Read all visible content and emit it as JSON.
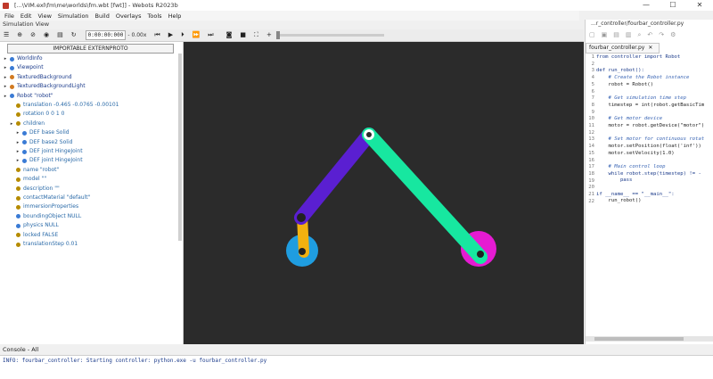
{
  "window": {
    "title": "[...\\VIM.exl\\fm\\me\\worlds\\fm.wbt [fwt]] - Webots R2023b",
    "minimize": "—",
    "maximize": "☐",
    "close": "✕"
  },
  "menu": [
    "File",
    "Edit",
    "View",
    "Simulation",
    "Build",
    "Overlays",
    "Tools",
    "Help"
  ],
  "simulation_view_label": "Simulation View",
  "toolbar": {
    "time": "0:00:00:000",
    "speed": "- 0.00x",
    "icons": [
      "menu-icon",
      "add-node-icon",
      "open-icon",
      "view-icon",
      "save-icon",
      "reload-icon",
      "step-back-icon",
      "play-icon",
      "step-icon",
      "run-fast-icon",
      "fast-forward-icon",
      "screenshot-icon",
      "record-icon",
      "fullscreen-icon",
      "plus-icon"
    ]
  },
  "scene_tree": {
    "extern_button": "IMPORTABLE EXTERNPROTO",
    "rows": [
      {
        "label": "WorldInfo",
        "color": "#3a7bd5",
        "indent": 0
      },
      {
        "label": "Viewpoint",
        "color": "#3a7bd5",
        "indent": 0
      },
      {
        "label": "TexturedBackground",
        "color": "#d17a22",
        "indent": 0
      },
      {
        "label": "TexturedBackgroundLight",
        "color": "#d17a22",
        "indent": 0
      },
      {
        "label": "Robot \"robot\"",
        "color": "#3a7bd5",
        "indent": 0
      },
      {
        "label": "translation -0.465 -0.0765 -0.00101",
        "color": "#b58b00",
        "indent": 1
      },
      {
        "label": "rotation 0 0 1 0",
        "color": "#b58b00",
        "indent": 1
      },
      {
        "label": "children",
        "color": "#b58b00",
        "indent": 1
      },
      {
        "label": "DEF base Solid",
        "color": "#3a7bd5",
        "indent": 2
      },
      {
        "label": "DEF base2 Solid",
        "color": "#3a7bd5",
        "indent": 2
      },
      {
        "label": "DEF joint HingeJoint",
        "color": "#3a7bd5",
        "indent": 2
      },
      {
        "label": "DEF joint HingeJoint",
        "color": "#3a7bd5",
        "indent": 2
      },
      {
        "label": "name \"robot\"",
        "color": "#b58b00",
        "indent": 1
      },
      {
        "label": "model \"\"",
        "color": "#b58b00",
        "indent": 1
      },
      {
        "label": "description \"\"",
        "color": "#b58b00",
        "indent": 1
      },
      {
        "label": "contactMaterial \"default\"",
        "color": "#b58b00",
        "indent": 1
      },
      {
        "label": "immersionProperties",
        "color": "#b58b00",
        "indent": 1
      },
      {
        "label": "boundingObject NULL",
        "color": "#3a7bd5",
        "indent": 1
      },
      {
        "label": "physics NULL",
        "color": "#3a7bd5",
        "indent": 1
      },
      {
        "label": "locked FALSE",
        "color": "#b58b00",
        "indent": 1
      },
      {
        "label": "translationStep 0.01",
        "color": "#b58b00",
        "indent": 1
      }
    ]
  },
  "editor": {
    "path": "...r_controller/fourbar_controller.py",
    "tab": "fourbar_controller.py",
    "tab_close": "✕",
    "line_numbers": [
      "1",
      "2",
      "3",
      "4",
      "5",
      "6",
      "7",
      "8",
      "9",
      "10",
      "11",
      "12",
      "13",
      "14",
      "15",
      "16",
      "17",
      "18",
      "19",
      "20",
      "21",
      "22"
    ],
    "lines": [
      "from controller import Robot",
      "",
      "def run_robot():",
      "    # Create the Robot instance",
      "    robot = Robot()",
      "",
      "    # Get simulation time step",
      "    timestep = int(robot.getBasicTim",
      "",
      "    # Get motor device",
      "    motor = robot.getDevice(\"motor\")",
      "",
      "    # Set motor for continuous rotat",
      "    motor.setPosition(float('inf'))",
      "    motor.setVelocity(1.0)",
      "",
      "    # Main control loop",
      "    while robot.step(timestep) != -",
      "        pass",
      "",
      "if __name__ == \"__main__\":",
      "    run_robot()"
    ]
  },
  "console": {
    "tab_label": "Console - All",
    "output": "INFO: fourbar_controller: Starting controller: python.exe -u fourbar_controller.py"
  },
  "colors": {
    "viewport_bg": "#2b2b2b",
    "link_purple": "#5a1fd1",
    "link_teal": "#17e7a0",
    "crank_yellow": "#f2b10f",
    "left_disc_blue": "#1f9de0",
    "right_disc_magenta": "#e51bd2"
  }
}
